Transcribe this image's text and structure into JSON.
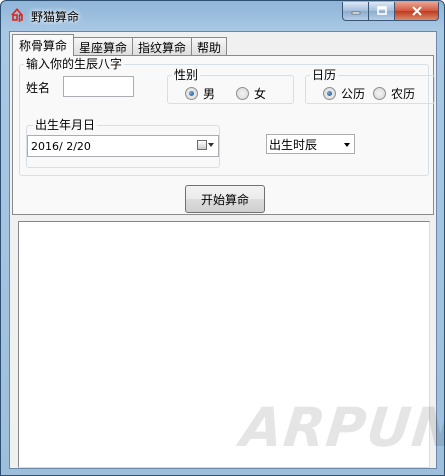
{
  "window": {
    "title": "野猫算命",
    "controls": {
      "minimize": "minimize-icon",
      "maximize": "maximize-icon",
      "close": "close-icon"
    }
  },
  "tabs": [
    {
      "label": "称骨算命",
      "active": true
    },
    {
      "label": "星座算命",
      "active": false
    },
    {
      "label": "指纹算命",
      "active": false
    },
    {
      "label": "帮助",
      "active": false
    }
  ],
  "form": {
    "group_title": "输入你的生辰八字",
    "name_label": "姓名",
    "name_value": "",
    "gender": {
      "title": "性别",
      "male": "男",
      "female": "女",
      "selected": "male"
    },
    "calendar": {
      "title": "日历",
      "solar": "公历",
      "lunar": "农历",
      "selected": "solar"
    },
    "birthdate": {
      "title": "出生年月日",
      "value": "2016/ 2/20"
    },
    "birth_time": {
      "value": "出生时辰"
    }
  },
  "start_button": "开始算命",
  "output_text": "",
  "watermark": "ARPUN"
}
